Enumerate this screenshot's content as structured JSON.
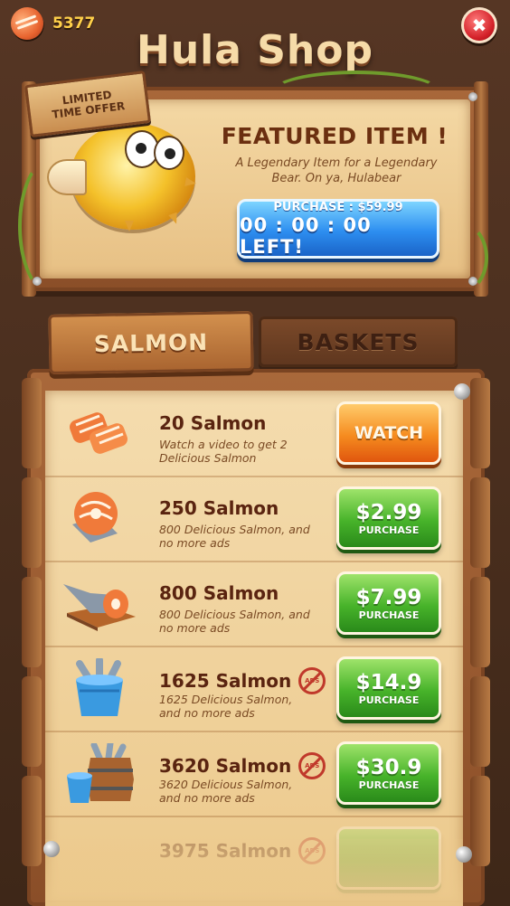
{
  "currency": {
    "value": "5377",
    "icon": "salmon-coin-icon"
  },
  "title": "Hula Shop",
  "featured": {
    "badge_line1": "LIMITED",
    "badge_line2": "TIME OFFER",
    "heading": "FEATURED ITEM !",
    "description": "A Legendary Item for a  Legendary Bear. On ya, Hulabear",
    "purchase_label": "PURCHASE : $59.99",
    "timer_label": "00 : 00 : 00 LEFT!"
  },
  "tabs": [
    {
      "label": "SALMON",
      "active": true
    },
    {
      "label": "BASKETS",
      "active": false
    }
  ],
  "items": [
    {
      "title": "20 Salmon",
      "desc": "Watch a video to get 2 Delicious Salmon",
      "button": "WATCH",
      "button_sub": "",
      "style": "orange",
      "noads": false,
      "icon": "salmon-fillets-icon"
    },
    {
      "title": "250 Salmon",
      "desc": "800 Delicious Salmon, and no more ads",
      "button": "$2.99",
      "button_sub": "PURCHASE",
      "style": "green",
      "noads": false,
      "icon": "salmon-steak-icon"
    },
    {
      "title": "800 Salmon",
      "desc": "800 Delicious Salmon, and no more ads",
      "button": "$7.99",
      "button_sub": "PURCHASE",
      "style": "green",
      "noads": false,
      "icon": "salmon-platter-icon"
    },
    {
      "title": "1625 Salmon",
      "desc": "1625 Delicious Salmon, and no more ads",
      "button": "$14.9",
      "button_sub": "PURCHASE",
      "style": "green",
      "noads": true,
      "icon": "fish-bucket-icon"
    },
    {
      "title": "3620 Salmon",
      "desc": "3620 Delicious Salmon, and no more ads",
      "button": "$30.9",
      "button_sub": "PURCHASE",
      "style": "green",
      "noads": true,
      "icon": "fish-barrel-icon"
    },
    {
      "title": "3975 Salmon",
      "desc": "",
      "button": "",
      "button_sub": "",
      "style": "green",
      "noads": true,
      "icon": "fish-barrel-icon"
    }
  ],
  "noads_label": "ADS"
}
